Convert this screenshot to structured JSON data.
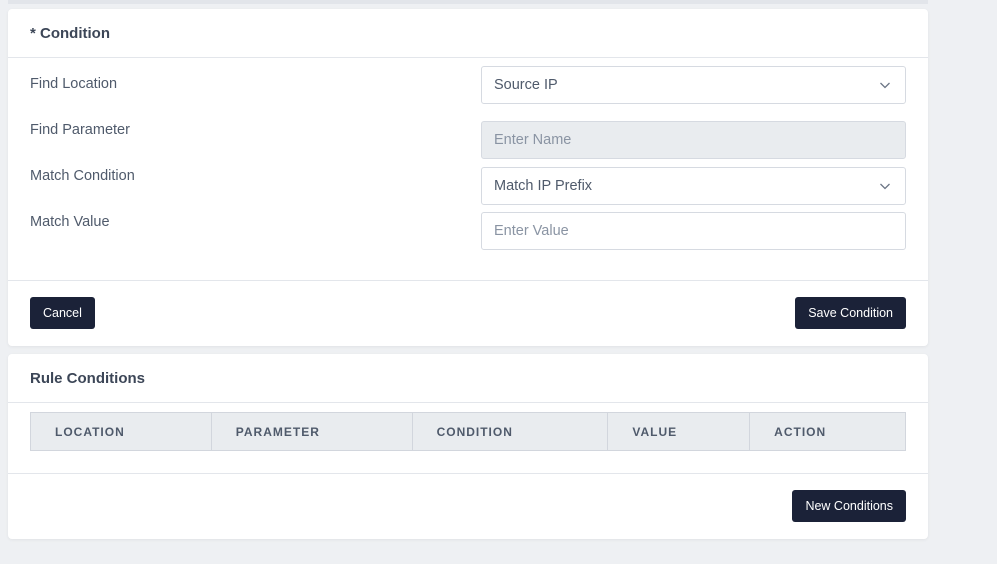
{
  "condition_form": {
    "title": "* Condition",
    "fields": [
      {
        "label": "Find Location",
        "type": "select",
        "value": "Source IP",
        "placeholder": ""
      },
      {
        "label": "Find Parameter",
        "type": "input-disabled",
        "value": "",
        "placeholder": "Enter Name"
      },
      {
        "label": "Match Condition",
        "type": "select",
        "value": "Match IP Prefix",
        "placeholder": ""
      },
      {
        "label": "Match Value",
        "type": "input",
        "value": "",
        "placeholder": "Enter Value"
      }
    ],
    "cancel_label": "Cancel",
    "save_label": "Save Condition"
  },
  "rule_conditions": {
    "title": "Rule Conditions",
    "columns": [
      "LOCATION",
      "PARAMETER",
      "CONDITION",
      "VALUE",
      "ACTION"
    ],
    "rows": [],
    "new_label": "New Conditions"
  },
  "icons": {
    "select_arrow": "chevron-down-icon"
  },
  "colors": {
    "primary_button": "#1b2238",
    "table_header_bg": "#e9ecef",
    "disabled_field_bg": "#e9ecef"
  }
}
